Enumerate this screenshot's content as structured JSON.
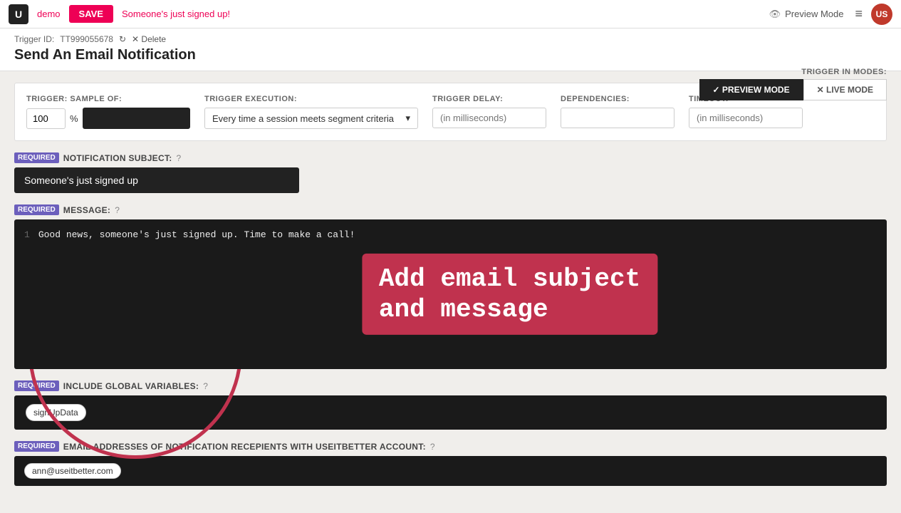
{
  "nav": {
    "logo": "U",
    "demo_label": "demo",
    "save_label": "SAVE",
    "trigger_name": "Someone's just signed up!",
    "preview_mode_label": "Preview Mode",
    "user_initials": "US"
  },
  "subheader": {
    "trigger_id_label": "Trigger ID:",
    "trigger_id_value": "TT999055678",
    "delete_label": "✕ Delete",
    "page_title": "Send An Email Notification",
    "trigger_modes_label": "TRIGGER IN MODES:",
    "preview_btn": "✓ PREVIEW MODE",
    "live_btn": "✕ LIVE MODE"
  },
  "config": {
    "trigger_label": "TRIGGER: SAMPLE OF:",
    "percent_value": "100",
    "percent_suffix": "%",
    "execution_label": "TRIGGER EXECUTION:",
    "execution_value": "Every time a session meets segment criteria",
    "delay_label": "TRIGGER DELAY:",
    "delay_placeholder": "(in milliseconds)",
    "deps_label": "DEPENDENCIES:",
    "deps_placeholder": "",
    "timeout_label": "TIMEOUT:",
    "timeout_placeholder": "(in milliseconds)"
  },
  "notification_subject": {
    "required_label": "Required",
    "field_label": "NOTIFICATION SUBJECT:",
    "help": "?",
    "value": "Someone's just signed up"
  },
  "message": {
    "required_label": "Required",
    "field_label": "MESSAGE:",
    "help": "?",
    "line_num": "1",
    "code": "Good news, someone's just signed up. Time to make a call!"
  },
  "annotation": {
    "line1": "Add email subject",
    "line2": "and message"
  },
  "global_variables": {
    "required_label": "Required",
    "field_label": "INCLUDE GLOBAL VARIABLES:",
    "help": "?",
    "tag": "signUpData"
  },
  "email_recipients": {
    "required_label": "Required",
    "field_label": "EMAIL ADDRESSES OF NOTIFICATION RECEPIENTS WITH USEITBETTER ACCOUNT:",
    "help": "?",
    "email": "ann@useitbetter.com"
  }
}
